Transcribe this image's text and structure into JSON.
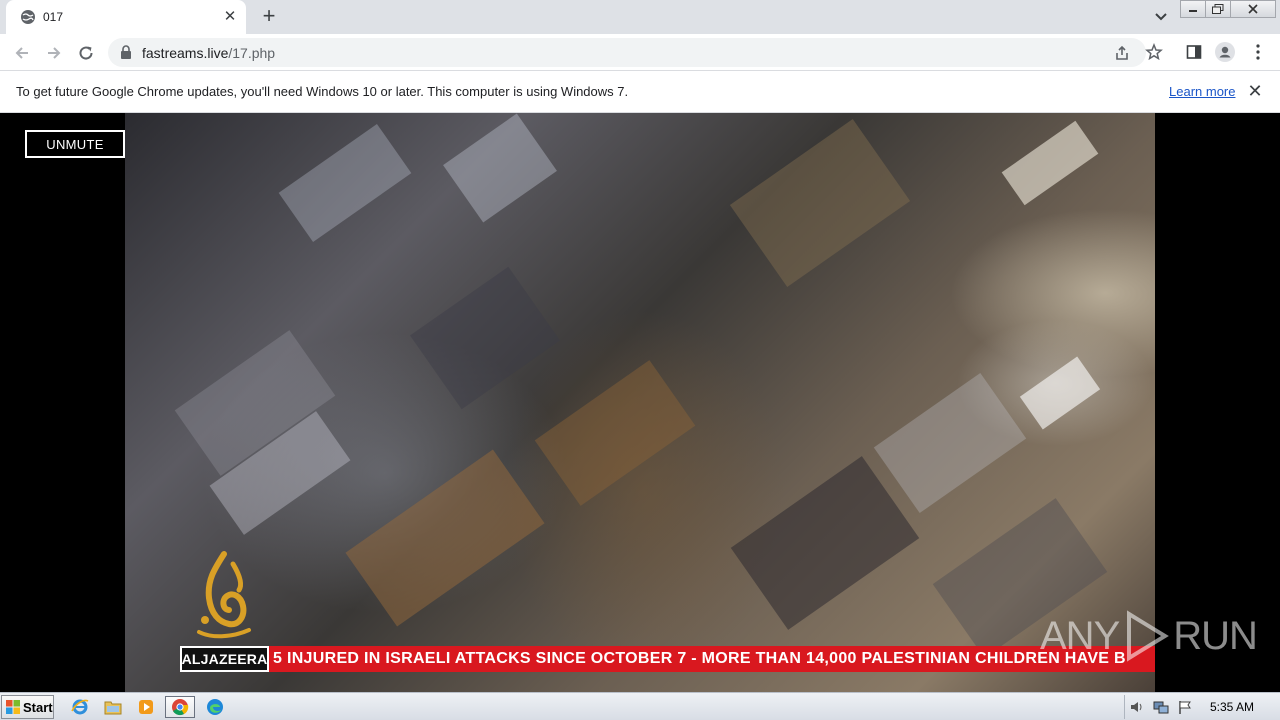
{
  "tab": {
    "title": "017",
    "favicon": "globe-icon"
  },
  "toolbar": {
    "url_host": "fastreams.live",
    "url_path": "/17.php"
  },
  "infobar": {
    "message": "To get future Google Chrome updates, you'll need Windows 10 or later. This computer is using Windows 7.",
    "learn_more": "Learn more"
  },
  "player": {
    "unmute_label": "UNMUTE",
    "channel_badge": "ALJAZEERA",
    "ticker_text": "5 INJURED IN ISRAELI ATTACKS SINCE OCTOBER 7   -   MORE THAN 14,000 PALESTINIAN CHILDREN HAVE B"
  },
  "watermark": {
    "left": "ANY",
    "right": "RUN"
  },
  "taskbar": {
    "start_label": "Start",
    "clock": "5:35 AM",
    "apps": [
      "ie-icon",
      "explorer-icon",
      "media-player-icon",
      "chrome-icon",
      "edge-icon"
    ]
  },
  "colors": {
    "ticker_red": "#d9181f",
    "link_blue": "#1a55c8",
    "logo_gold": "#d9a026"
  }
}
